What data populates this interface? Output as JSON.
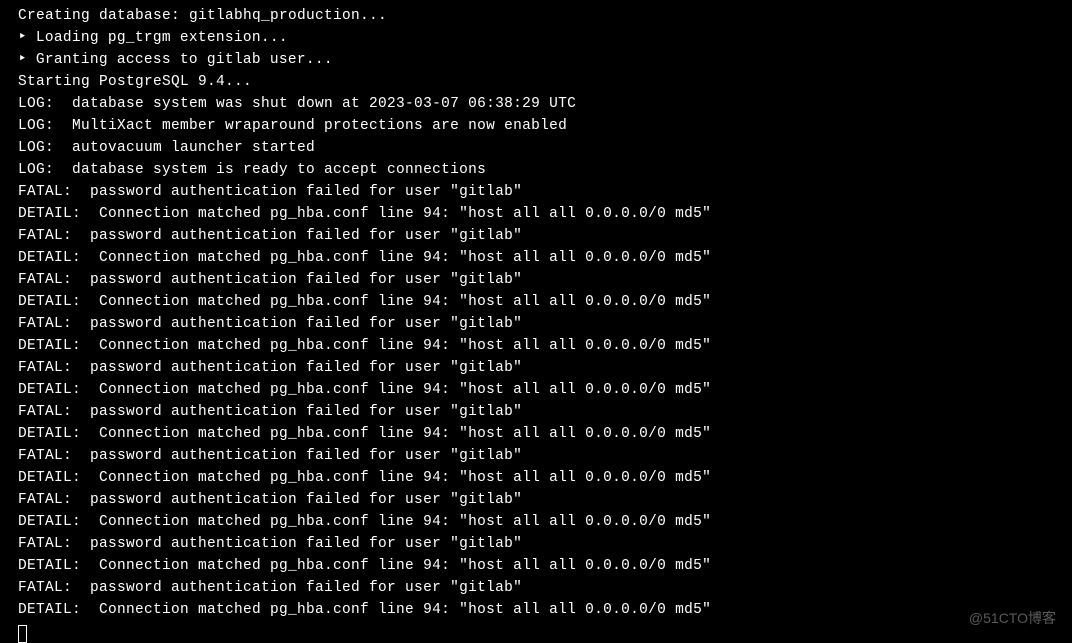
{
  "terminal": {
    "lines": [
      "Creating database: gitlabhq_production...",
      "‣ Loading pg_trgm extension...",
      "‣ Granting access to gitlab user...",
      "Starting PostgreSQL 9.4...",
      "LOG:  database system was shut down at 2023-03-07 06:38:29 UTC",
      "LOG:  MultiXact member wraparound protections are now enabled",
      "LOG:  autovacuum launcher started",
      "LOG:  database system is ready to accept connections",
      "FATAL:  password authentication failed for user \"gitlab\"",
      "DETAIL:  Connection matched pg_hba.conf line 94: \"host all all 0.0.0.0/0 md5\"",
      "FATAL:  password authentication failed for user \"gitlab\"",
      "DETAIL:  Connection matched pg_hba.conf line 94: \"host all all 0.0.0.0/0 md5\"",
      "FATAL:  password authentication failed for user \"gitlab\"",
      "DETAIL:  Connection matched pg_hba.conf line 94: \"host all all 0.0.0.0/0 md5\"",
      "FATAL:  password authentication failed for user \"gitlab\"",
      "DETAIL:  Connection matched pg_hba.conf line 94: \"host all all 0.0.0.0/0 md5\"",
      "FATAL:  password authentication failed for user \"gitlab\"",
      "DETAIL:  Connection matched pg_hba.conf line 94: \"host all all 0.0.0.0/0 md5\"",
      "FATAL:  password authentication failed for user \"gitlab\"",
      "DETAIL:  Connection matched pg_hba.conf line 94: \"host all all 0.0.0.0/0 md5\"",
      "FATAL:  password authentication failed for user \"gitlab\"",
      "DETAIL:  Connection matched pg_hba.conf line 94: \"host all all 0.0.0.0/0 md5\"",
      "FATAL:  password authentication failed for user \"gitlab\"",
      "DETAIL:  Connection matched pg_hba.conf line 94: \"host all all 0.0.0.0/0 md5\"",
      "FATAL:  password authentication failed for user \"gitlab\"",
      "DETAIL:  Connection matched pg_hba.conf line 94: \"host all all 0.0.0.0/0 md5\"",
      "FATAL:  password authentication failed for user \"gitlab\"",
      "DETAIL:  Connection matched pg_hba.conf line 94: \"host all all 0.0.0.0/0 md5\""
    ]
  },
  "watermark": "@51CTO博客"
}
